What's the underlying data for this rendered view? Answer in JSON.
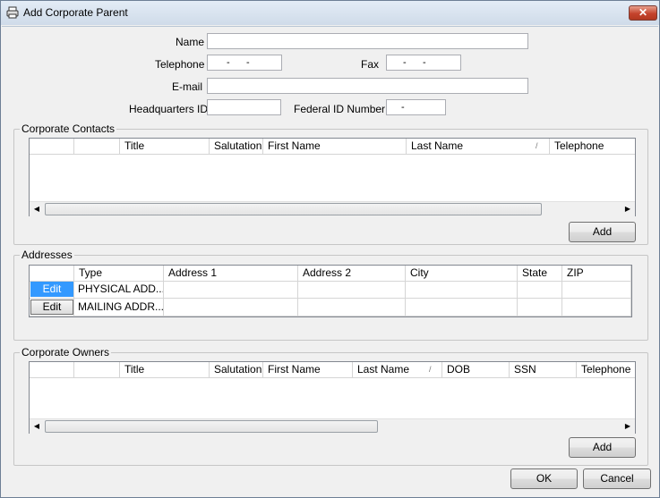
{
  "window": {
    "title": "Add Corporate Parent",
    "close_glyph": "✕"
  },
  "form": {
    "name_label": "Name",
    "name_value": "",
    "telephone_label": "Telephone",
    "telephone_mask": "-      -",
    "fax_label": "Fax",
    "fax_mask": "-      -",
    "email_label": "E-mail",
    "email_value": "",
    "hq_label": "Headquarters ID",
    "hq_value": "",
    "federal_label": "Federal ID Number",
    "federal_mask": "-"
  },
  "contacts": {
    "title": "Corporate Contacts",
    "columns": [
      "",
      "",
      "Title",
      "Salutation",
      "First Name",
      "Last Name",
      "Telephone"
    ],
    "sort_glyph": "/",
    "add_label": "Add"
  },
  "addresses": {
    "title": "Addresses",
    "columns": [
      "",
      "Type",
      "Address 1",
      "Address 2",
      "City",
      "State",
      "ZIP"
    ],
    "rows": [
      {
        "edit": "Edit",
        "type": "PHYSICAL ADD...",
        "address1": "",
        "address2": "",
        "city": "",
        "state": "",
        "zip": ""
      },
      {
        "edit": "Edit",
        "type": "MAILING ADDR...",
        "address1": "",
        "address2": "",
        "city": "",
        "state": "",
        "zip": ""
      }
    ]
  },
  "owners": {
    "title": "Corporate Owners",
    "columns": [
      "",
      "",
      "Title",
      "Salutation",
      "First Name",
      "Last Name",
      "DOB",
      "SSN",
      "Telephone"
    ],
    "sort_glyph": "/",
    "add_label": "Add"
  },
  "footer": {
    "ok_label": "OK",
    "cancel_label": "Cancel"
  },
  "icons": {
    "left_arrow": "◀",
    "right_arrow": "▶"
  }
}
